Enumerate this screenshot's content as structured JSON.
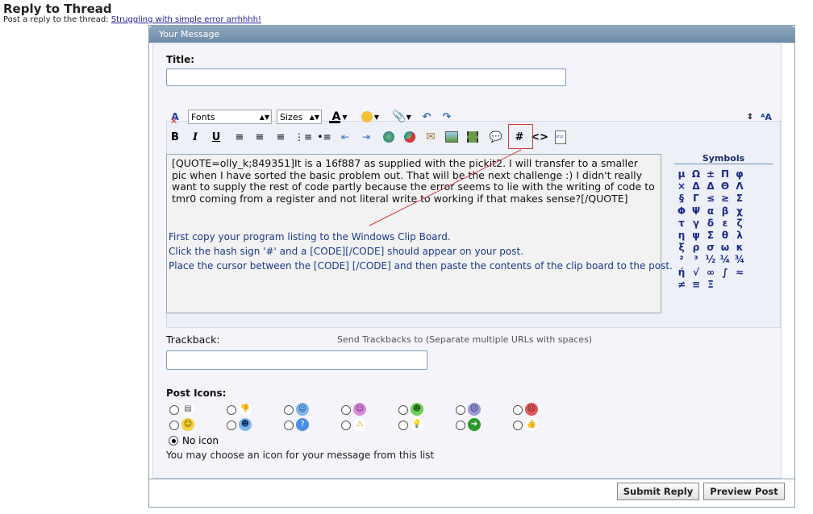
{
  "header": {
    "title": "Reply to Thread",
    "subtitle_prefix": "Post a reply to the thread:",
    "thread_link": "Struggling with simple error arrhhhh!"
  },
  "panel": {
    "heading": "Your Message"
  },
  "form": {
    "title_label": "Title:",
    "title_value": "",
    "trackback_label": "Trackback:",
    "trackback_hint": "Send Trackbacks to (Separate multiple URLs with spaces)",
    "trackback_value": "",
    "post_icons_label": "Post Icons:",
    "no_icon_label": "No icon",
    "icon_hint": "You may choose an icon for your message from this list"
  },
  "toolbar": {
    "font_select": "Fonts",
    "size_select": "Sizes",
    "icons": [
      "remove-format-icon",
      "text-color-icon",
      "smilie-icon",
      "attach-icon",
      "undo-icon",
      "redo-icon",
      "bold-icon",
      "italic-icon",
      "underline-icon",
      "align-left-icon",
      "align-center-icon",
      "align-right-icon",
      "ordered-list-icon",
      "unordered-list-icon",
      "outdent-icon",
      "indent-icon",
      "link-icon",
      "unlink-icon",
      "email-icon",
      "image-icon",
      "video-icon",
      "quote-icon",
      "code-icon",
      "html-icon",
      "php-icon"
    ],
    "bold": "B",
    "italic": "I",
    "underline": "U",
    "code_hash": "#",
    "html_tag": "<>"
  },
  "editor": {
    "quote_text": "[QUOTE=olly_k;849351]It is a 16f887 as supplied with the pickit2. I will transfer to a smaller pic when I have sorted the basic problem out. That will be the next challenge :) I didn't really want to supply the rest of code partly because the error seems to lie with the writing of code to tmr0 coming from a register and not literal write to working if that makes sense?[/QUOTE]",
    "instructions": [
      "First copy your program listing to the Windows Clip Board.",
      "Click the hash sign '#' and a [CODE][/CODE] should appear on your post.",
      "Place the cursor between the [CODE]  [/CODE] and then paste the contents of the clip board to the post."
    ]
  },
  "symbols": {
    "title": "Symbols",
    "items": [
      "μ",
      "Ω",
      "±",
      "Π",
      "φ",
      "×",
      "Δ",
      "Δ",
      "Θ",
      "Λ",
      "§",
      "Γ",
      "≤",
      "≥",
      "Σ",
      "Φ",
      "Ψ",
      "α",
      "β",
      "χ",
      "τ",
      "γ",
      "δ",
      "ε",
      "ζ",
      "η",
      "ψ",
      "Σ",
      "θ",
      "λ",
      "ξ",
      "ρ",
      "σ",
      "ω",
      "κ",
      "²",
      "³",
      "½",
      "¼",
      "¾",
      "ή",
      "√",
      "∞",
      "∫",
      "≈",
      "≠",
      "≡",
      "Ξ"
    ]
  },
  "post_icons": [
    {
      "name": "post-icon-document",
      "glyph": "▤",
      "bg": "#ffffff",
      "fg": "#555"
    },
    {
      "name": "post-icon-thumbs-down",
      "glyph": "👎",
      "bg": "#ffffff",
      "fg": "#c0392b"
    },
    {
      "name": "post-icon-smile-blue",
      "glyph": "☺",
      "bg": "#7fb6e8",
      "fg": "#0b3d7a"
    },
    {
      "name": "post-icon-tongue",
      "glyph": "☺",
      "bg": "#d88bd8",
      "fg": "#5a1a5a"
    },
    {
      "name": "post-icon-grin",
      "glyph": "☻",
      "bg": "#6fcf5a",
      "fg": "#1f5a11"
    },
    {
      "name": "post-icon-sad",
      "glyph": "☹",
      "bg": "#9a9ad8",
      "fg": "#22225a"
    },
    {
      "name": "post-icon-angry",
      "glyph": "☹",
      "bg": "#e05a5a",
      "fg": "#5a0a0a"
    },
    {
      "name": "post-icon-smile-yellow",
      "glyph": "☺",
      "bg": "#f2d23a",
      "fg": "#5a4a00"
    },
    {
      "name": "post-icon-cool",
      "glyph": "☻",
      "bg": "#7fb6e8",
      "fg": "#0b2d5a"
    },
    {
      "name": "post-icon-question",
      "glyph": "?",
      "bg": "#4a8fe0",
      "fg": "#ffffff"
    },
    {
      "name": "post-icon-warning",
      "glyph": "⚠",
      "bg": "#ffffff",
      "fg": "#d6a000"
    },
    {
      "name": "post-icon-lightbulb",
      "glyph": "💡",
      "bg": "#ffffff",
      "fg": "#e0c000"
    },
    {
      "name": "post-icon-arrow",
      "glyph": "➔",
      "bg": "#2a9a2a",
      "fg": "#ffffff"
    },
    {
      "name": "post-icon-thumbs-up",
      "glyph": "👍",
      "bg": "#ffffff",
      "fg": "#d68a1a"
    }
  ],
  "buttons": {
    "submit": "Submit Reply",
    "preview": "Preview Post"
  },
  "colors": {
    "panel_header": "#7f9ab4",
    "symbols": "#1a2a8a",
    "instructions": "#1b3a8a",
    "highlight": "#dd3333"
  }
}
